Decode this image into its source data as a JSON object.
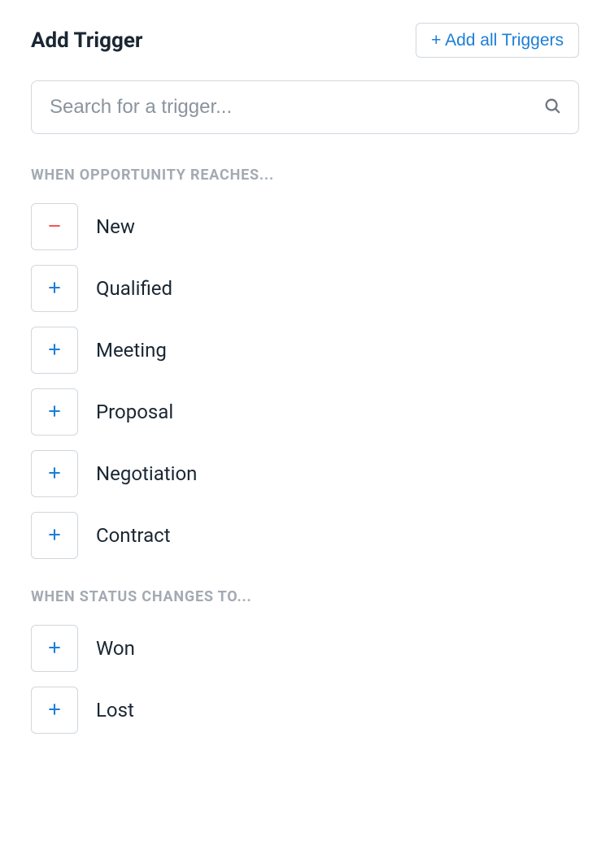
{
  "header": {
    "title": "Add Trigger",
    "add_all_label": "+ Add all Triggers"
  },
  "search": {
    "placeholder": "Search for a trigger..."
  },
  "colors": {
    "accent": "#1c7ed6",
    "remove": "#fa5252"
  },
  "sections": [
    {
      "title": "When Opportunity Reaches...",
      "items": [
        {
          "label": "New",
          "state": "remove"
        },
        {
          "label": "Qualified",
          "state": "add"
        },
        {
          "label": "Meeting",
          "state": "add"
        },
        {
          "label": "Proposal",
          "state": "add"
        },
        {
          "label": "Negotiation",
          "state": "add"
        },
        {
          "label": "Contract",
          "state": "add"
        }
      ]
    },
    {
      "title": "When Status Changes To...",
      "items": [
        {
          "label": "Won",
          "state": "add"
        },
        {
          "label": "Lost",
          "state": "add"
        }
      ]
    }
  ]
}
